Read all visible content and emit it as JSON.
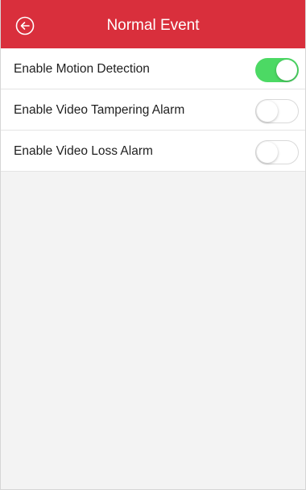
{
  "header": {
    "title": "Normal Event",
    "back_icon": "back-arrow-circle-icon",
    "background_color": "#d92f3c"
  },
  "settings": [
    {
      "label": "Enable Motion Detection",
      "enabled": true
    },
    {
      "label": "Enable Video Tampering Alarm",
      "enabled": false
    },
    {
      "label": "Enable Video Loss Alarm",
      "enabled": false
    }
  ],
  "colors": {
    "toggle_on": "#4cd964",
    "toggle_off": "#ffffff",
    "page_background": "#f3f3f3"
  }
}
